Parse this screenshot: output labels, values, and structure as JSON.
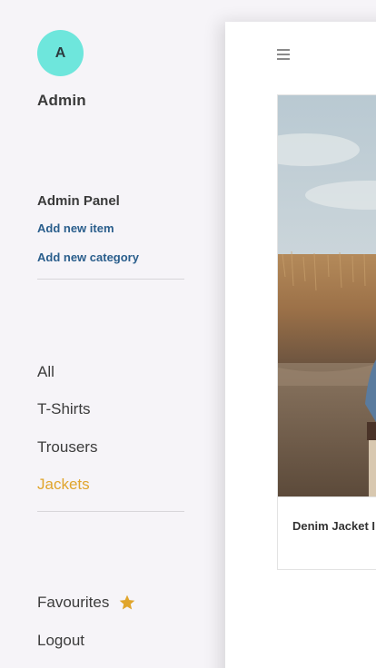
{
  "user": {
    "avatar_letter": "A",
    "name": "Admin"
  },
  "admin_panel": {
    "title": "Admin Panel",
    "links": [
      {
        "label": "Add new item"
      },
      {
        "label": "Add new category"
      }
    ]
  },
  "categories": {
    "active_index": 3,
    "items": [
      {
        "label": "All"
      },
      {
        "label": "T-Shirts"
      },
      {
        "label": "Trousers"
      },
      {
        "label": "Jackets"
      }
    ]
  },
  "footer_nav": {
    "favourites_label": "Favourites",
    "favourites_icon": "star-icon",
    "logout_label": "Logout"
  },
  "main": {
    "menu_icon": "hamburger-menu-icon",
    "product": {
      "title": "Denim Jacket I"
    }
  },
  "colors": {
    "avatar_bg": "#6ee6dc",
    "link": "#2a5e8c",
    "active_category": "#e0a52c",
    "star": "#e0a52c",
    "background": "#f6f4f8"
  }
}
